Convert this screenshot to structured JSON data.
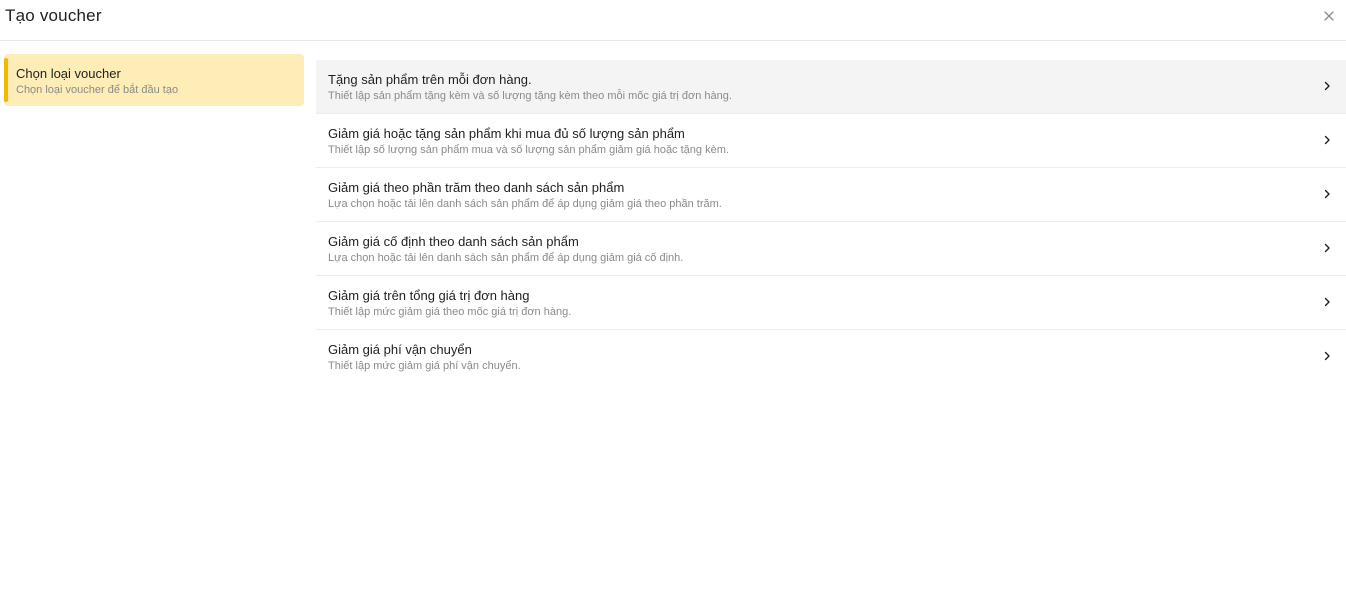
{
  "modal": {
    "title": "Tạo voucher",
    "close_icon": "close-icon"
  },
  "sidebar": {
    "steps": [
      {
        "title": "Chọn loại voucher",
        "subtitle": "Chọn loại voucher để bắt đầu tạo",
        "active": true,
        "accent": "#f5b800",
        "background": "#ffedb8"
      }
    ]
  },
  "options": [
    {
      "title": "Tặng sản phẩm trên mỗi đơn hàng.",
      "description": "Thiết lập sản phẩm tặng kèm và số lượng tặng kèm theo mỗi mốc giá trị đơn hàng.",
      "icon": "chevron-right-icon",
      "hovered": true
    },
    {
      "title": "Giảm giá hoặc tặng sản phẩm khi mua đủ số lượng sản phẩm",
      "description": "Thiết lập số lượng sản phẩm mua và số lượng sản phẩm giảm giá hoặc tặng kèm.",
      "icon": "chevron-right-icon",
      "hovered": false
    },
    {
      "title": "Giảm giá theo phần trăm theo danh sách sản phẩm",
      "description": "Lựa chọn hoặc tải lên danh sách sản phẩm để áp dụng giảm giá theo phần trăm.",
      "icon": "chevron-right-icon",
      "hovered": false
    },
    {
      "title": "Giảm giá cố định theo danh sách sản phẩm",
      "description": "Lựa chọn hoặc tải lên danh sách sản phẩm để áp dụng giảm giá cố định.",
      "icon": "chevron-right-icon",
      "hovered": false
    },
    {
      "title": "Giảm giá trên tổng giá trị đơn hàng",
      "description": "Thiết lập mức giảm giá theo mốc giá trị đơn hàng.",
      "icon": "chevron-right-icon",
      "hovered": false
    },
    {
      "title": "Giảm giá phí vận chuyển",
      "description": "Thiết lập mức giảm giá phí vận chuyển.",
      "icon": "chevron-right-icon",
      "hovered": false
    }
  ]
}
